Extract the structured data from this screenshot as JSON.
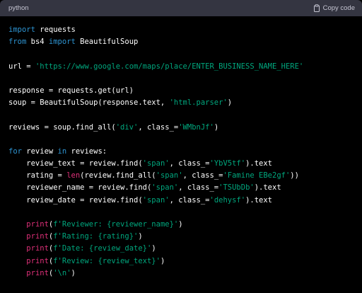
{
  "header": {
    "language": "python",
    "copy_label": "Copy code",
    "copy_icon": "clipboard-icon"
  },
  "code": {
    "lines": [
      [
        {
          "t": "import",
          "c": "kw"
        },
        {
          "t": " requests",
          "c": "plain"
        }
      ],
      [
        {
          "t": "from",
          "c": "kw"
        },
        {
          "t": " bs4 ",
          "c": "plain"
        },
        {
          "t": "import",
          "c": "kw"
        },
        {
          "t": " BeautifulSoup",
          "c": "plain"
        }
      ],
      [],
      [
        {
          "t": "url = ",
          "c": "plain"
        },
        {
          "t": "'https://www.google.com/maps/place/ENTER_BUSINESS_NAME_HERE'",
          "c": "str"
        }
      ],
      [],
      [
        {
          "t": "response = requests.get(url)",
          "c": "plain"
        }
      ],
      [
        {
          "t": "soup = BeautifulSoup(response.text, ",
          "c": "plain"
        },
        {
          "t": "'html.parser'",
          "c": "str"
        },
        {
          "t": ")",
          "c": "plain"
        }
      ],
      [],
      [
        {
          "t": "reviews = soup.find_all(",
          "c": "plain"
        },
        {
          "t": "'div'",
          "c": "str"
        },
        {
          "t": ", class_=",
          "c": "plain"
        },
        {
          "t": "'WMbnJf'",
          "c": "str"
        },
        {
          "t": ")",
          "c": "plain"
        }
      ],
      [],
      [
        {
          "t": "for",
          "c": "kw"
        },
        {
          "t": " review ",
          "c": "plain"
        },
        {
          "t": "in",
          "c": "kw"
        },
        {
          "t": " reviews:",
          "c": "plain"
        }
      ],
      [
        {
          "t": "    review_text = review.find(",
          "c": "plain"
        },
        {
          "t": "'span'",
          "c": "str"
        },
        {
          "t": ", class_=",
          "c": "plain"
        },
        {
          "t": "'YbV5tf'",
          "c": "str"
        },
        {
          "t": ").text",
          "c": "plain"
        }
      ],
      [
        {
          "t": "    rating = ",
          "c": "plain"
        },
        {
          "t": "len",
          "c": "fn"
        },
        {
          "t": "(review.find_all(",
          "c": "plain"
        },
        {
          "t": "'span'",
          "c": "str"
        },
        {
          "t": ", class_=",
          "c": "plain"
        },
        {
          "t": "'Famine EBe2gf'",
          "c": "str"
        },
        {
          "t": "))",
          "c": "plain"
        }
      ],
      [
        {
          "t": "    reviewer_name = review.find(",
          "c": "plain"
        },
        {
          "t": "'span'",
          "c": "str"
        },
        {
          "t": ", class_=",
          "c": "plain"
        },
        {
          "t": "'TSUbDb'",
          "c": "str"
        },
        {
          "t": ").text",
          "c": "plain"
        }
      ],
      [
        {
          "t": "    review_date = review.find(",
          "c": "plain"
        },
        {
          "t": "'span'",
          "c": "str"
        },
        {
          "t": ", class_=",
          "c": "plain"
        },
        {
          "t": "'dehysf'",
          "c": "str"
        },
        {
          "t": ").text",
          "c": "plain"
        }
      ],
      [],
      [
        {
          "t": "    ",
          "c": "plain"
        },
        {
          "t": "print",
          "c": "fn"
        },
        {
          "t": "(",
          "c": "plain"
        },
        {
          "t": "f'Reviewer: {reviewer_name}'",
          "c": "str"
        },
        {
          "t": ")",
          "c": "plain"
        }
      ],
      [
        {
          "t": "    ",
          "c": "plain"
        },
        {
          "t": "print",
          "c": "fn"
        },
        {
          "t": "(",
          "c": "plain"
        },
        {
          "t": "f'Rating: {rating}'",
          "c": "str"
        },
        {
          "t": ")",
          "c": "plain"
        }
      ],
      [
        {
          "t": "    ",
          "c": "plain"
        },
        {
          "t": "print",
          "c": "fn"
        },
        {
          "t": "(",
          "c": "plain"
        },
        {
          "t": "f'Date: {review_date}'",
          "c": "str"
        },
        {
          "t": ")",
          "c": "plain"
        }
      ],
      [
        {
          "t": "    ",
          "c": "plain"
        },
        {
          "t": "print",
          "c": "fn"
        },
        {
          "t": "(",
          "c": "plain"
        },
        {
          "t": "f'Review: {review_text}'",
          "c": "str"
        },
        {
          "t": ")",
          "c": "plain"
        }
      ],
      [
        {
          "t": "    ",
          "c": "plain"
        },
        {
          "t": "print",
          "c": "fn"
        },
        {
          "t": "(",
          "c": "plain"
        },
        {
          "t": "'\\n'",
          "c": "str"
        },
        {
          "t": ")",
          "c": "plain"
        }
      ]
    ]
  },
  "colors": {
    "background": "#000000",
    "header": "#343541",
    "keyword": "#2e95d3",
    "string": "#00a67d",
    "builtin": "#df3079",
    "text": "#ffffff"
  }
}
